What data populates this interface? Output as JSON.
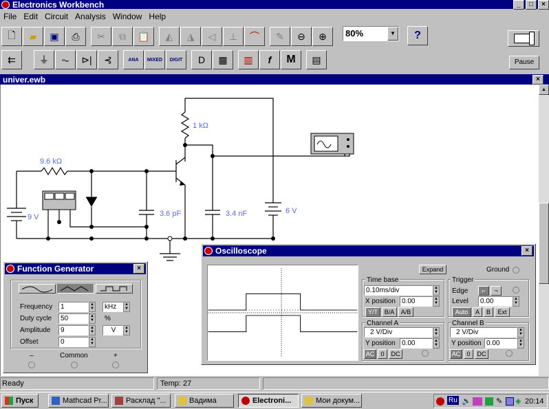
{
  "app": {
    "title": "Electronics Workbench"
  },
  "menu": [
    "File",
    "Edit",
    "Circuit",
    "Analysis",
    "Window",
    "Help"
  ],
  "toolbar": {
    "zoom": "80%",
    "help": "?",
    "pause": "Pause"
  },
  "parts_bin": {
    "ana": "ANA",
    "mixed": "MIXED",
    "digit": "DIGIT",
    "m": "M",
    "f": "f"
  },
  "document": {
    "title": "univer.ewb"
  },
  "circuit": {
    "r_base": "9.6 kΩ",
    "r_collector": "1 kΩ",
    "battery_left": "9 V",
    "battery_right": "6 V",
    "cap_1": "3.6 pF",
    "cap_2": "3.4 nF"
  },
  "function_generator": {
    "title": "Function Generator",
    "frequency_label": "Frequency",
    "frequency": "1",
    "frequency_unit": "kHz",
    "duty_label": "Duty cycle",
    "duty": "50",
    "duty_unit": "%",
    "amplitude_label": "Amplitude",
    "amplitude": "9",
    "amplitude_unit": "V",
    "offset_label": "Offset",
    "offset": "0",
    "term_minus": "–",
    "term_common": "Common",
    "term_plus": "+"
  },
  "oscilloscope": {
    "title": "Oscilloscope",
    "expand": "Expand",
    "ground": "Ground",
    "timebase_label": "Time base",
    "timebase": "0.10ms/div",
    "xpos_label": "X position",
    "xpos": "0.00",
    "mode_yt": "Y/T",
    "mode_ba": "B/A",
    "mode_ab": "A/B",
    "trigger_label": "Trigger",
    "edge_label": "Edge",
    "level_label": "Level",
    "level": "0.00",
    "trig_auto": "Auto",
    "trig_a": "A",
    "trig_b": "B",
    "trig_ext": "Ext",
    "cha_label": "Channel A",
    "cha_scale": "2 V/Div",
    "cha_ypos_label": "Y position",
    "cha_ypos": "0.00",
    "chb_label": "Channel B",
    "chb_scale": "2 V/Div",
    "chb_ypos_label": "Y position",
    "chb_ypos": "0.00",
    "coup_ac": "AC",
    "coup_0": "0",
    "coup_dc": "DC"
  },
  "status": {
    "text": "Ready",
    "temp": "Temp:  27"
  },
  "taskbar": {
    "start": "Пуск",
    "tasks": [
      "Mathcad Pr...",
      "Расклад \"...",
      "Вадима",
      "Electroni...",
      "Мои докум..."
    ],
    "tray_lang": "Ru",
    "clock": "20:14"
  }
}
